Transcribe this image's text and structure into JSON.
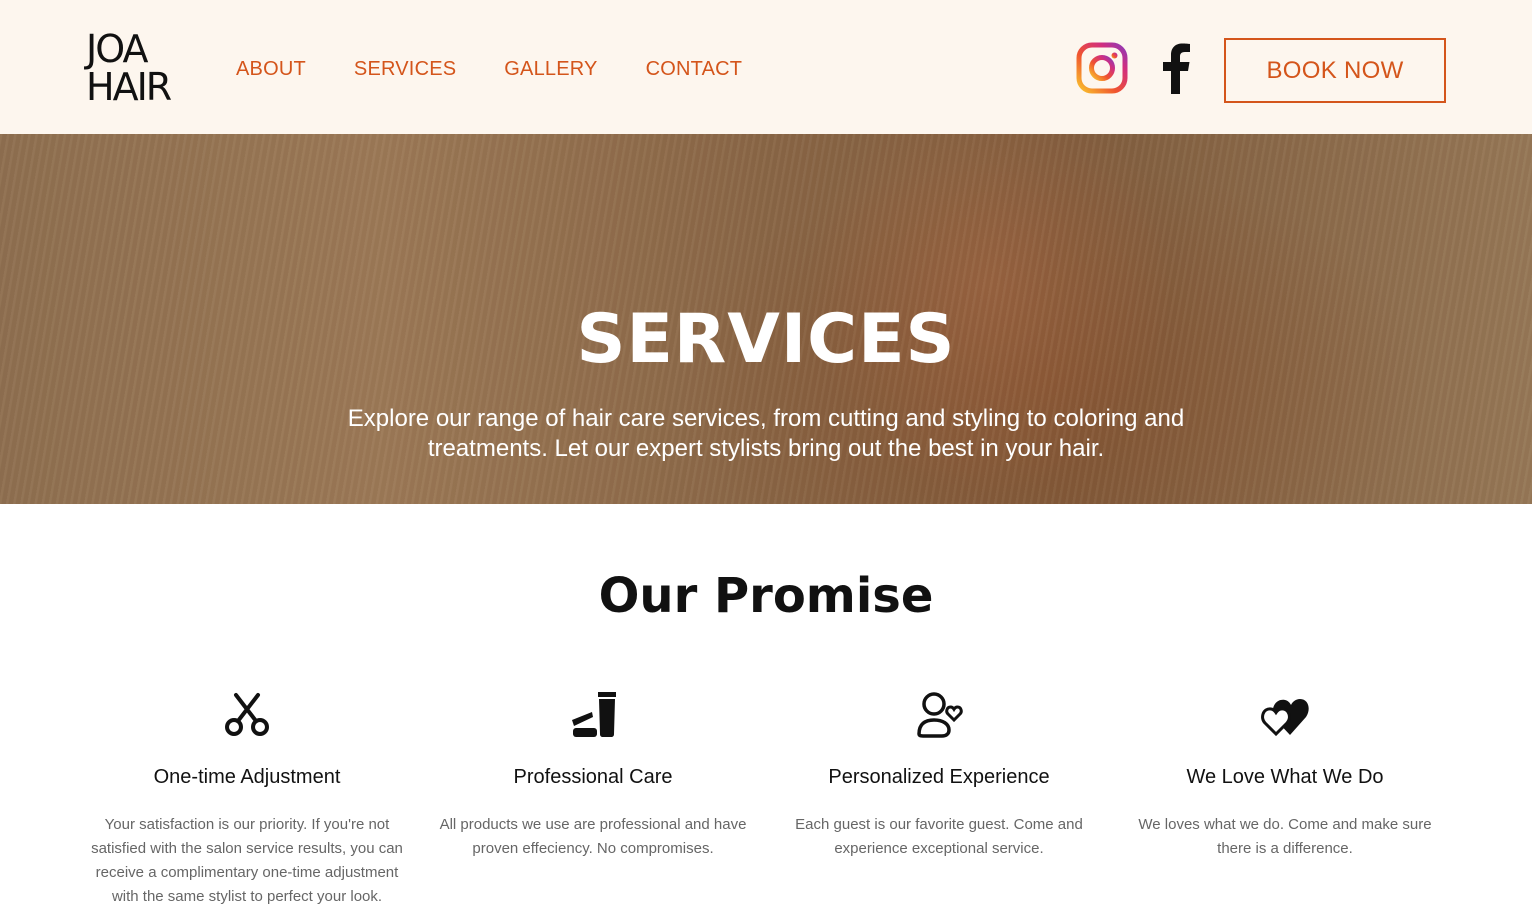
{
  "brand": {
    "logo_line1": "JOA",
    "logo_line2": "HAIR"
  },
  "nav": {
    "items": [
      {
        "label": "ABOUT"
      },
      {
        "label": "SERVICES"
      },
      {
        "label": "GALLERY"
      },
      {
        "label": "CONTACT"
      }
    ]
  },
  "social": {
    "instagram_icon": "instagram-icon",
    "facebook_icon": "facebook-icon"
  },
  "header": {
    "book_label": "BOOK NOW"
  },
  "hero": {
    "title": "SERVICES",
    "text": "Explore our range of hair care services, from cutting and styling to coloring and treatments. Let our expert stylists bring out the best in your hair."
  },
  "promise": {
    "title": "Our Promise",
    "cards": [
      {
        "icon": "scissors-icon",
        "title": "One-time Adjustment",
        "text": "Your satisfaction is our priority. If you're not satisfied with the salon service results, you can receive a complimentary one-time adjustment with the same stylist to perfect your look."
      },
      {
        "icon": "hair-products-icon",
        "title": "Professional Care",
        "text": "All products we use are professional and have proven effeciency. No compromises."
      },
      {
        "icon": "person-heart-icon",
        "title": "Personalized Experience",
        "text": "Each guest is our favorite guest. Come and experience exceptional service."
      },
      {
        "icon": "hearts-icon",
        "title": "We Love What We Do",
        "text": "We loves what we do. Come and make sure there is a difference."
      }
    ]
  },
  "colors": {
    "accent": "#d4551b",
    "header_bg": "#fdf6ee"
  }
}
